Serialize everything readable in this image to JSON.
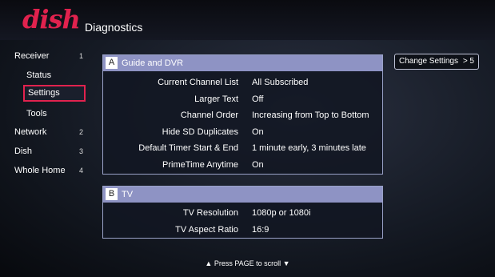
{
  "header": {
    "logo": "dish",
    "title": "Diagnostics"
  },
  "sidebar": {
    "items": [
      {
        "label": "Receiver",
        "num": "1"
      },
      {
        "label": "Network",
        "num": "2"
      },
      {
        "label": "Dish",
        "num": "3"
      },
      {
        "label": "Whole Home",
        "num": "4"
      }
    ],
    "sub_items": [
      {
        "label": "Status"
      },
      {
        "label": "Settings",
        "selected": true
      },
      {
        "label": "Tools"
      }
    ]
  },
  "panels": [
    {
      "letter": "A",
      "title": "Guide and DVR",
      "rows": [
        {
          "label": "Current Channel List",
          "value": "All Subscribed"
        },
        {
          "label": "Larger Text",
          "value": "Off"
        },
        {
          "label": "Channel Order",
          "value": "Increasing from Top to Bottom"
        },
        {
          "label": "Hide SD Duplicates",
          "value": "On"
        },
        {
          "label": "Default Timer Start & End",
          "value": "1 minute early, 3 minutes late"
        },
        {
          "label": "PrimeTime Anytime",
          "value": "On"
        }
      ]
    },
    {
      "letter": "B",
      "title": "TV",
      "rows": [
        {
          "label": "TV Resolution",
          "value": "1080p or 1080i"
        },
        {
          "label": "TV Aspect Ratio",
          "value": "16:9"
        }
      ]
    }
  ],
  "change_settings": {
    "label": "Change Settings",
    "shortcut": "> 5"
  },
  "footer": {
    "text": "▲ Press PAGE to scroll ▼"
  },
  "colors": {
    "brand": "#e1224e",
    "panel_header": "#8e93c4"
  }
}
